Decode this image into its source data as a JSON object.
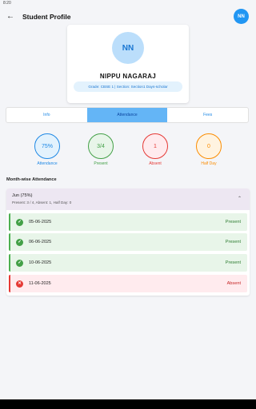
{
  "status_bar": {
    "time": "8:20"
  },
  "app_bar": {
    "title": "Student Profile",
    "back_icon": "arrow-back-icon",
    "avatar_initials": "NN"
  },
  "profile": {
    "initials": "NN",
    "name": "NIPPU NAGARAJ",
    "details": "Grade: CBSE 1 | Section: Section1 Days-scholar"
  },
  "tabs": [
    {
      "label": "Info",
      "active": false
    },
    {
      "label": "Attendance",
      "active": true
    },
    {
      "label": "Fees",
      "active": false
    }
  ],
  "stats": [
    {
      "value": "75%",
      "label": "Attendance",
      "color": "#1e88e5",
      "bg": "#e3f2fd"
    },
    {
      "value": "3/4",
      "label": "Present",
      "color": "#43a047",
      "bg": "#e8f5e9"
    },
    {
      "value": "1",
      "label": "Absent",
      "color": "#e53935",
      "bg": "#ffebee"
    },
    {
      "value": "0",
      "label": "Half Day",
      "color": "#fb8c00",
      "bg": "#fff3e0"
    }
  ],
  "section_title": "Month-wise Attendance",
  "month": {
    "title": "Jun (75%)",
    "summary": "Present: 3 / 4, Absent: 1, Half Day: 0",
    "records": [
      {
        "date": "05-06-2025",
        "status": "Present",
        "icon": "check-circle-icon"
      },
      {
        "date": "06-06-2025",
        "status": "Present",
        "icon": "check-circle-icon"
      },
      {
        "date": "10-06-2025",
        "status": "Present",
        "icon": "check-circle-icon"
      },
      {
        "date": "11-06-2025",
        "status": "Absent",
        "icon": "cancel-circle-icon"
      }
    ]
  }
}
